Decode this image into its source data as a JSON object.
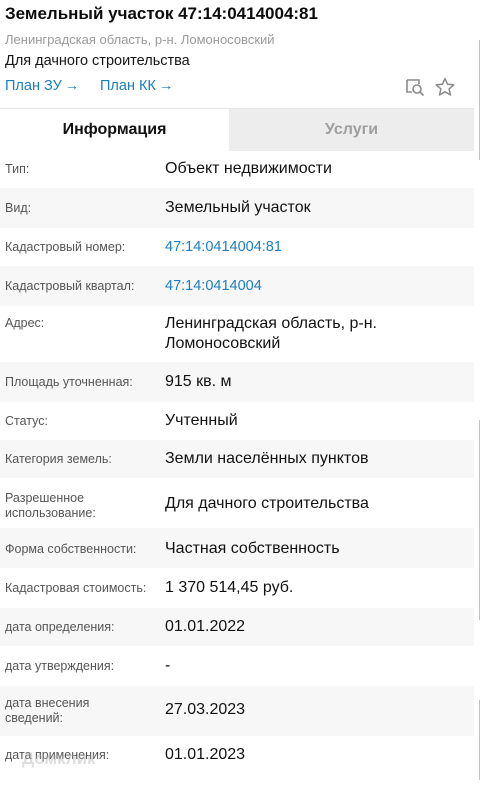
{
  "header": {
    "title": "Земельный участок 47:14:0414004:81",
    "region": "Ленинградская область, р-н. Ломоносовский",
    "purpose": "Для дачного строительства",
    "links": [
      {
        "label": "План ЗУ",
        "arrow": "→"
      },
      {
        "label": "План КК",
        "arrow": "→"
      }
    ],
    "icons": [
      "zoom-to-object-icon",
      "star-icon"
    ]
  },
  "tabs": [
    {
      "label": "Информация",
      "active": true
    },
    {
      "label": "Услуги",
      "active": false
    }
  ],
  "rows": [
    {
      "label": "Тип:",
      "value": "Объект недвижимости"
    },
    {
      "label": "Вид:",
      "value": "Земельный участок"
    },
    {
      "label": "Кадастровый номер:",
      "value": "47:14:0414004:81",
      "is_link": true
    },
    {
      "label": "Кадастровый квартал:",
      "value": "47:14:0414004",
      "is_link": true
    },
    {
      "label": "Адрес:",
      "value": "Ленинградская область, р-н. Ломоносовский"
    },
    {
      "label": "Площадь уточненная:",
      "value": "915 кв. м"
    },
    {
      "label": "Статус:",
      "value": "Учтенный"
    },
    {
      "label": "Категория земель:",
      "value": "Земли населённых пунктов"
    },
    {
      "label": "Разрешенное использование:",
      "value": "Для дачного строительства"
    },
    {
      "label": "Форма собственности:",
      "value": "Частная собственность"
    },
    {
      "label": "Кадастровая стоимость:",
      "value": "1 370 514,45 руб."
    },
    {
      "label": "дата определения:",
      "value": "01.01.2022"
    },
    {
      "label": "дата утверждения:",
      "value": "-"
    },
    {
      "label": "дата внесения сведений:",
      "value": "27.03.2023"
    },
    {
      "label": "дата применения:",
      "value": "01.01.2023"
    }
  ],
  "watermark": "Домклик",
  "colors": {
    "link": "#1b7ec2",
    "tab_inactive_bg": "#ededed",
    "row_alt_bg": "#f7f7f8"
  }
}
